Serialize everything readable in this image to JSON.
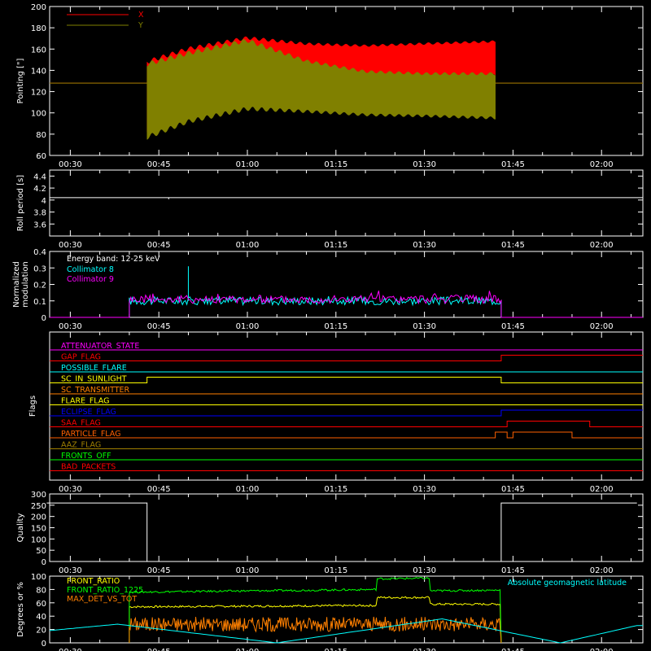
{
  "time_ticks": [
    "00:30",
    "00:45",
    "01:00",
    "01:15",
    "01:30",
    "01:45",
    "02:00"
  ],
  "chart_data": [
    {
      "type": "line",
      "ylabel": "Pointing [\"]",
      "ylim": [
        60,
        200
      ],
      "yticks": [
        60,
        80,
        100,
        120,
        140,
        160,
        180,
        200
      ],
      "series": [
        {
          "name": "X",
          "color": "#ff0000",
          "envelope_x": [
            "00:43",
            "00:50",
            "01:00",
            "01:10",
            "01:20",
            "01:30",
            "01:42"
          ],
          "envelope_top": [
            150,
            162,
            172,
            166,
            164,
            166,
            168
          ],
          "envelope_bottom": [
            80,
            100,
            118,
            125,
            130,
            130,
            135
          ],
          "baseline": 128
        },
        {
          "name": "Y",
          "color": "#808000",
          "envelope_x": [
            "00:43",
            "00:50",
            "01:00",
            "01:10",
            "01:20",
            "01:30",
            "01:42"
          ],
          "envelope_top": [
            148,
            158,
            170,
            150,
            140,
            138,
            138
          ],
          "envelope_bottom": [
            75,
            90,
            102,
            100,
            97,
            96,
            94
          ],
          "baseline": 128
        }
      ]
    },
    {
      "type": "line",
      "ylabel": "Roll period [s]",
      "ylim": [
        3.4,
        4.5
      ],
      "yticks": [
        3.6,
        3.8,
        4.0,
        4.2,
        4.4
      ],
      "series": [
        {
          "color": "#ffffff",
          "value": 4.04
        }
      ]
    },
    {
      "type": "line",
      "ylabel": [
        "Normalized",
        "modulation"
      ],
      "ylim": [
        0,
        0.4
      ],
      "yticks": [
        0,
        0.1,
        0.2,
        0.3,
        0.4
      ],
      "annotation": "Energy band: 12-25 keV",
      "active_range": [
        "00:40",
        "01:43"
      ],
      "series": [
        {
          "name": "Collimator 8",
          "color": "#00ffff",
          "mean": 0.1,
          "spike": {
            "x": "00:50",
            "y": 0.31
          }
        },
        {
          "name": "Collimator 9",
          "color": "#ff00ff",
          "mean": 0.11
        }
      ]
    },
    {
      "type": "line",
      "ylabel": "Flags",
      "flags": [
        {
          "name": "ATTENUATOR_STATE",
          "color": "#ff00ff",
          "steps": []
        },
        {
          "name": "GAP_FLAG",
          "color": "#ff0000",
          "steps": [
            [
              "01:43",
              1
            ]
          ]
        },
        {
          "name": "POSSIBLE_FLARE",
          "color": "#00ffff",
          "steps": []
        },
        {
          "name": "SC_IN_SUNLIGHT",
          "color": "#ffff00",
          "steps": [
            [
              "00:43",
              1
            ],
            [
              "01:43",
              0
            ]
          ]
        },
        {
          "name": "SC_TRANSMITTER",
          "color": "#ff8000",
          "steps": []
        },
        {
          "name": "FLARE_FLAG",
          "color": "#ffff00",
          "steps": []
        },
        {
          "name": "ECLIPSE_FLAG",
          "color": "#0000ff",
          "steps": [
            [
              "00:43",
              0
            ],
            [
              "01:43",
              1
            ]
          ]
        },
        {
          "name": "SAA_FLAG",
          "color": "#ff0000",
          "steps": [
            [
              "01:44",
              1
            ],
            [
              "01:58",
              0
            ]
          ]
        },
        {
          "name": "PARTICLE_FLAG",
          "color": "#ff6000",
          "steps": [
            [
              "01:42",
              1
            ],
            [
              "01:44",
              0
            ],
            [
              "01:45",
              1
            ],
            [
              "01:55",
              0
            ]
          ]
        },
        {
          "name": "AAZ_FLAG",
          "color": "#a08000",
          "steps": []
        },
        {
          "name": "FRONTS_OFF",
          "color": "#00ff00",
          "steps": []
        },
        {
          "name": "BAD_PACKETS",
          "color": "#ff0000",
          "steps": []
        }
      ]
    },
    {
      "type": "line",
      "ylabel": "Quality",
      "ylim": [
        0,
        300
      ],
      "yticks": [
        0,
        50,
        100,
        150,
        200,
        250,
        300
      ],
      "series": [
        {
          "color": "#ffffff",
          "x": [
            "00:26",
            "00:43",
            "00:43",
            "01:43",
            "01:43",
            "02:06"
          ],
          "y": [
            260,
            260,
            0,
            0,
            260,
            260
          ]
        }
      ]
    },
    {
      "type": "line",
      "ylabel": "Degrees or %",
      "ylim": [
        0,
        100
      ],
      "yticks": [
        0,
        20,
        40,
        60,
        80,
        100
      ],
      "annotation": "Absolute geomagnetic latitude",
      "annotation_color": "#00ffff",
      "series": [
        {
          "name": "FRONT_RATIO",
          "color": "#ffff00",
          "x": [
            "00:40",
            "01:22",
            "01:22",
            "01:31",
            "01:31",
            "01:43"
          ],
          "y": [
            54,
            56,
            68,
            68,
            58,
            58
          ]
        },
        {
          "name": "FRONT_RATIO_1225",
          "color": "#00ff00",
          "x": [
            "00:40",
            "01:22",
            "01:22",
            "01:31",
            "01:31",
            "01:43"
          ],
          "y": [
            76,
            80,
            96,
            97,
            78,
            79
          ]
        },
        {
          "name": "MAX_DET_VS_TOT",
          "color": "#ff8000",
          "mean": 28
        },
        {
          "color": "#00ffff",
          "x": [
            "00:26",
            "00:38",
            "01:05",
            "01:33",
            "01:53",
            "02:06"
          ],
          "y": [
            18,
            28,
            0,
            36,
            0,
            26
          ]
        }
      ]
    }
  ]
}
